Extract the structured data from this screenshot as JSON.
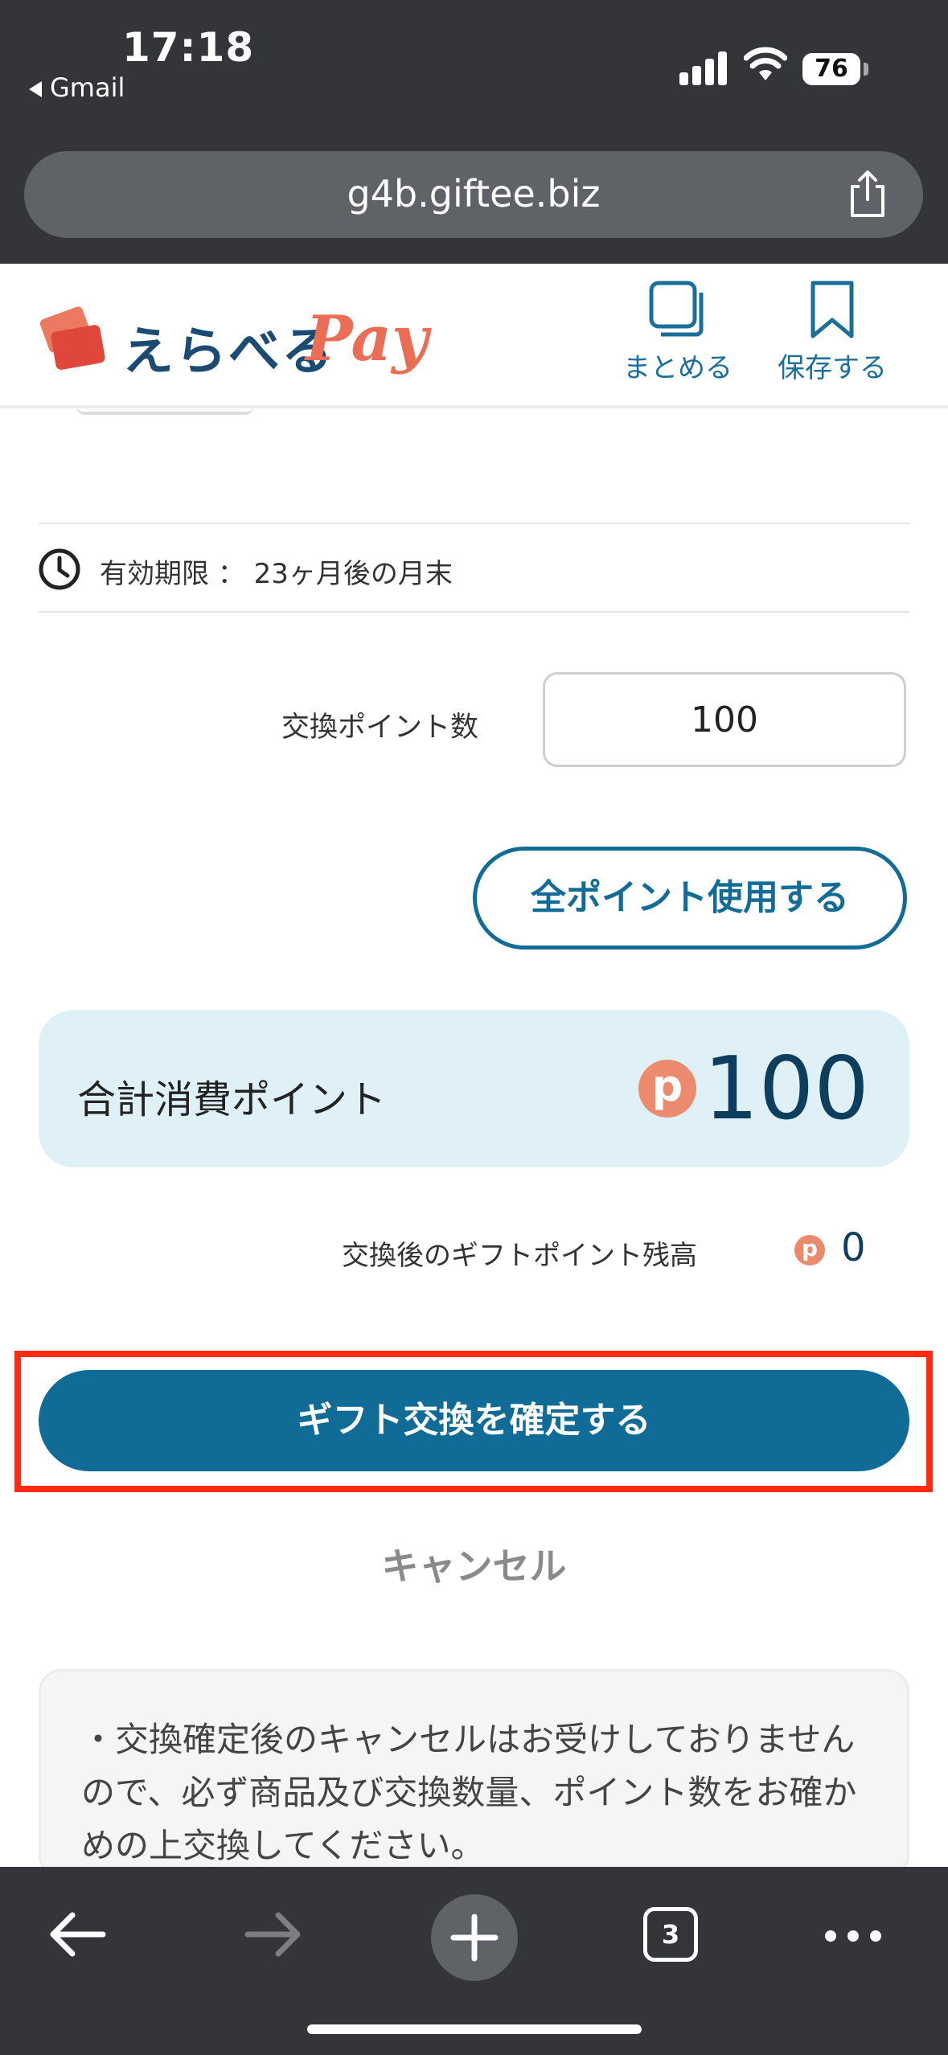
{
  "status_bar": {
    "time": "17:18",
    "back_app": "Gmail",
    "battery": "76"
  },
  "browser": {
    "url": "g4b.giftee.biz"
  },
  "header": {
    "logo_text": "えらべる",
    "logo_pay": "Pay",
    "summarize_label": "まとめる",
    "save_label": "保存する"
  },
  "expiry": {
    "label": "有効期限 ： 23ヶ月後の月末"
  },
  "exchange": {
    "points_label": "交換ポイント数",
    "points_value": "100",
    "use_all_label": "全ポイント使用する"
  },
  "total": {
    "label": "合計消費ポイント",
    "badge": "p",
    "value": "100"
  },
  "balance": {
    "label": "交換後のギフトポイント残高",
    "badge": "p",
    "value": "0"
  },
  "actions": {
    "confirm_label": "ギフト交換を確定する",
    "cancel_label": "キャンセル"
  },
  "notice": {
    "text": "・交換確定後のキャンセルはお受けしておりませんので、必ず商品及び交換数量、ポイント数をお確かめの上交換してください。"
  },
  "toolbar": {
    "tab_count": "3"
  },
  "colors": {
    "brand_navy": "#1b4a72",
    "brand_coral": "#ea6d55",
    "primary_blue": "#106b96",
    "highlight_red": "#ff2a12",
    "total_bg": "#dff0f7"
  }
}
